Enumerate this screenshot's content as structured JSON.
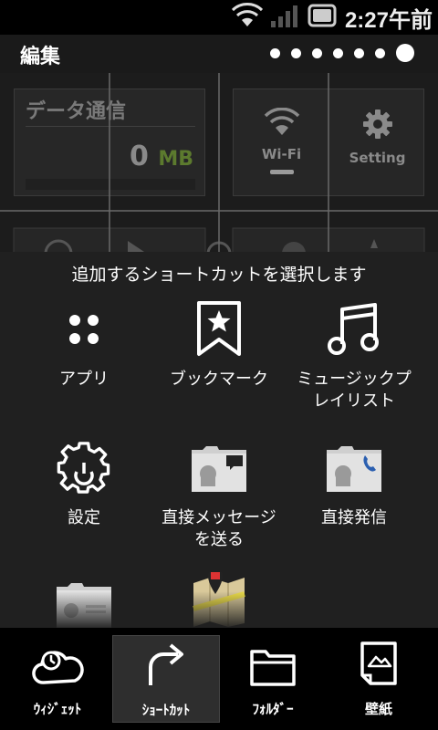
{
  "status_bar": {
    "time": "2:27午前"
  },
  "header": {
    "title": "編集",
    "page_dot_count": 7,
    "active_page": 7
  },
  "home_screen": {
    "data_widget": {
      "title": "データ通信",
      "value": "0",
      "unit": "MB"
    },
    "switch_widget": {
      "wifi_label": "Wi-Fi",
      "setting_label": "Setting"
    }
  },
  "dialog": {
    "title": "追加するショートカットを選択します",
    "options": [
      {
        "label": "アプリ",
        "icon": "apps-icon"
      },
      {
        "label": "ブックマーク",
        "icon": "bookmark-icon"
      },
      {
        "label": "ミュージックプ\nレイリスト",
        "icon": "music-playlist-icon"
      },
      {
        "label": "設定",
        "icon": "settings-gear-icon"
      },
      {
        "label": "直接メッセージ\nを送る",
        "icon": "direct-message-icon"
      },
      {
        "label": "直接発信",
        "icon": "direct-dial-icon"
      },
      {
        "label": "",
        "icon": "android-folder-icon"
      },
      {
        "label": "",
        "icon": "maps-icon"
      }
    ]
  },
  "tabs": [
    {
      "label": "ｳｨｼﾞｪｯﾄ",
      "icon": "widget-cloud-icon",
      "selected": false
    },
    {
      "label": "ｼｮｰﾄｶｯﾄ",
      "icon": "shortcut-arrow-icon",
      "selected": true
    },
    {
      "label": "ﾌｫﾙﾀﾞｰ",
      "icon": "folder-icon",
      "selected": false
    },
    {
      "label": "壁紙",
      "icon": "wallpaper-icon",
      "selected": false
    }
  ]
}
